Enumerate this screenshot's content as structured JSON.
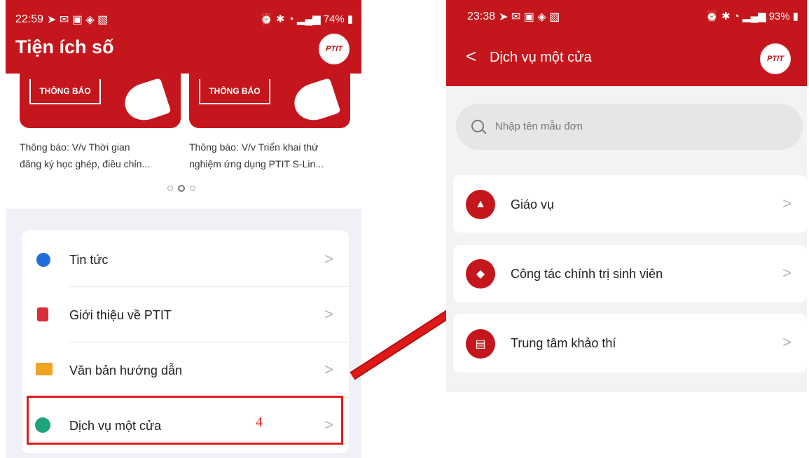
{
  "left": {
    "status": {
      "time": "22:59",
      "battery": "74%"
    },
    "header": {
      "title": "Tiện ích số",
      "logo_text": "PTIT"
    },
    "news": [
      {
        "tag": "THÔNG BÁO",
        "line1": "Thông báo: V/v Thời gian",
        "line2": "đăng ký học ghép, điều chỉn..."
      },
      {
        "tag": "THÔNG BÁO",
        "line1": "Thông báo: V/v Triển khai thứ",
        "line2": "nghiệm ứng dụng PTIT S-Lin..."
      }
    ],
    "menu": [
      {
        "label": "Tin tức",
        "chevron": ">"
      },
      {
        "label": "Giới thiệu về PTIT",
        "chevron": ">"
      },
      {
        "label": "Văn bản hướng dẫn",
        "chevron": ">"
      },
      {
        "label": "Dịch vụ một cửa",
        "chevron": ">"
      }
    ],
    "annotation": "4"
  },
  "right": {
    "status": {
      "time": "23:38",
      "battery": "93%"
    },
    "header": {
      "back": "<",
      "title": "Dịch vụ một cửa",
      "logo_text": "PTIT"
    },
    "search": {
      "placeholder": "Nhập tên mẫu đơn"
    },
    "items": [
      {
        "label": "Giáo vụ",
        "chevron": ">"
      },
      {
        "label": "Công tác chính trị sinh viên",
        "chevron": ">"
      },
      {
        "label": "Trung tâm khảo thí",
        "chevron": ">"
      }
    ]
  },
  "colors": {
    "brand": "#c4161c",
    "highlight_box": "#e11b1b",
    "arrow": "#d81616"
  }
}
